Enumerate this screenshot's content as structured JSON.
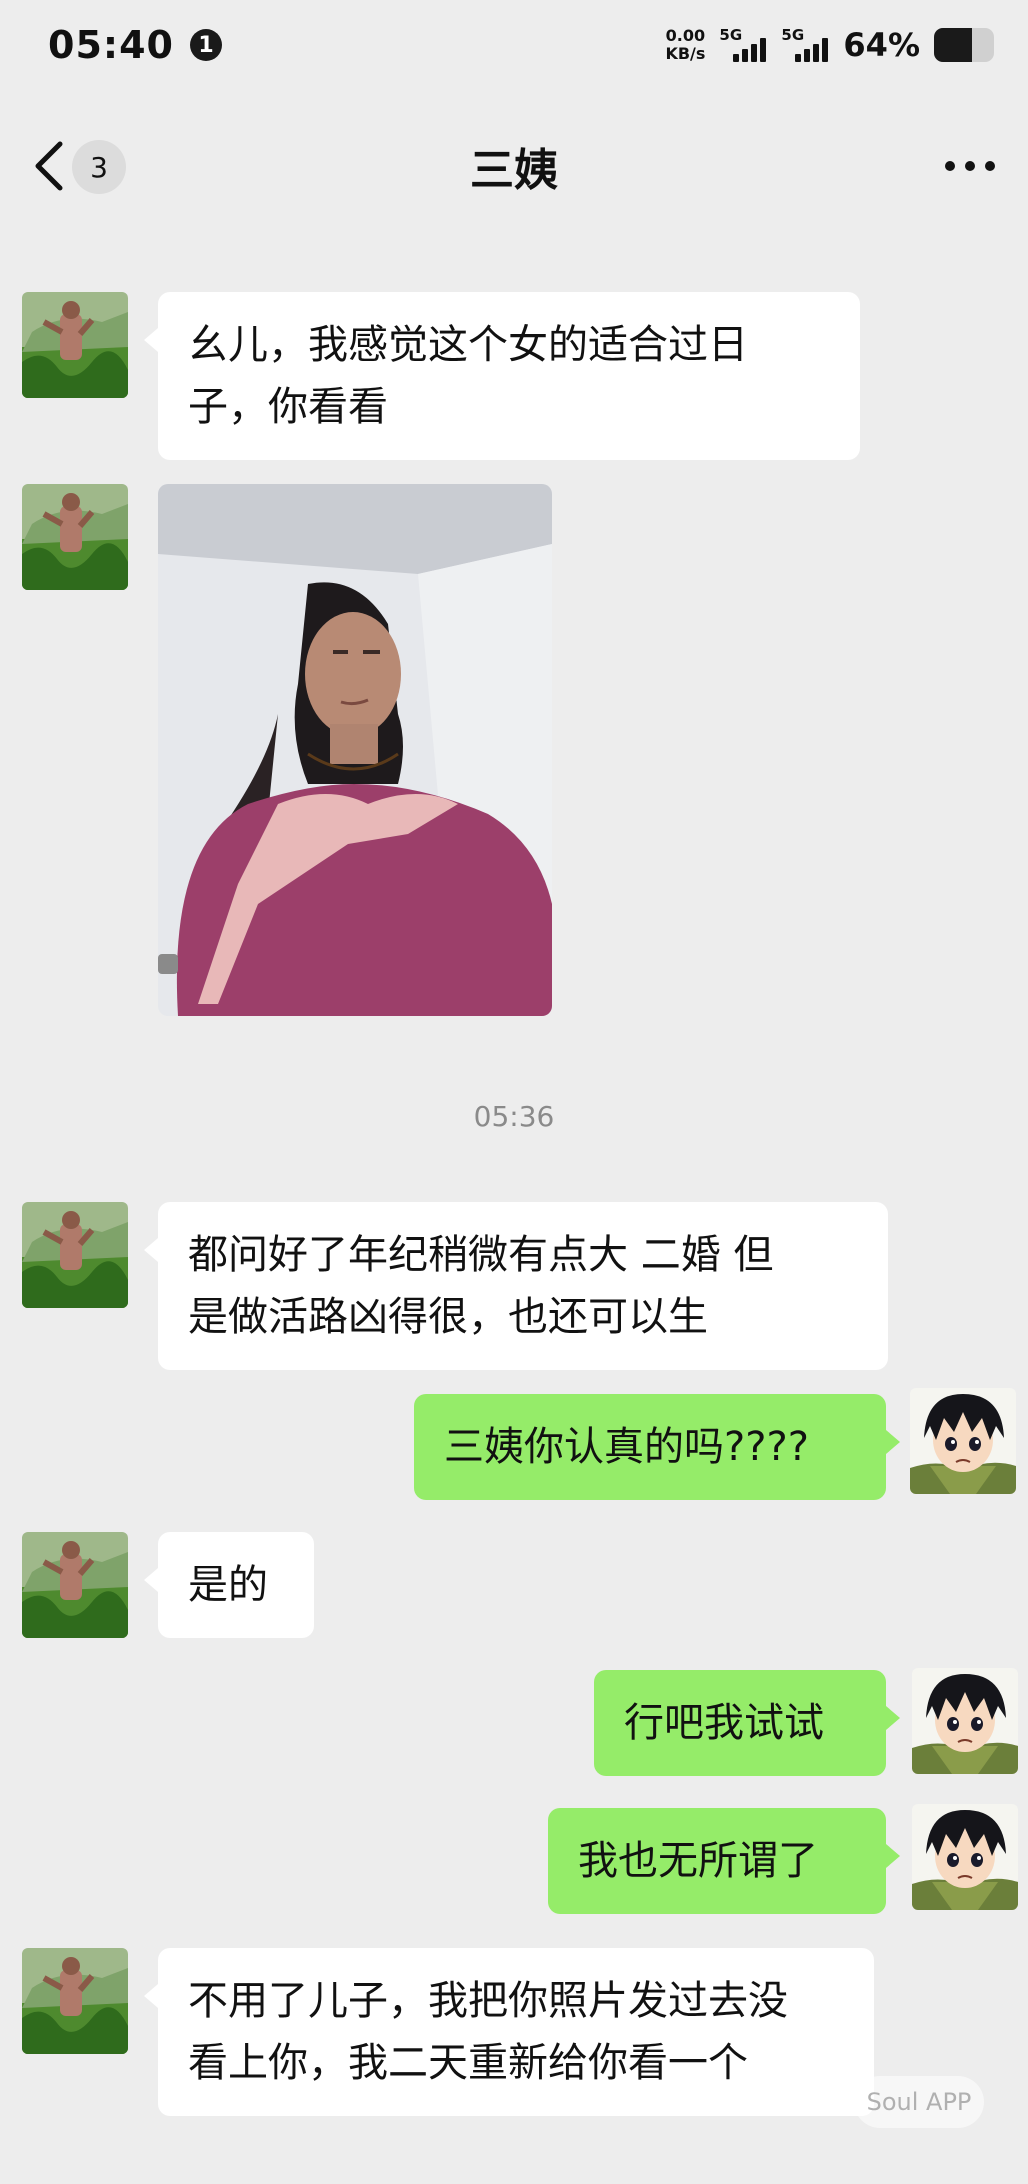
{
  "status_bar": {
    "time": "05:40",
    "notification_count": "1",
    "net_speed_value": "0.00",
    "net_speed_unit": "KB/s",
    "sim1_label": "5G",
    "sim2_label": "5G",
    "battery_percent_text": "64%",
    "battery_level": 0.64
  },
  "nav": {
    "unread_count": "3",
    "title": "三姨"
  },
  "messages": [
    {
      "sender": "contact",
      "type": "text",
      "text_line1": "幺儿，我感觉这个女的适合过日",
      "text_line2": "子，你看看"
    },
    {
      "sender": "contact",
      "type": "image"
    },
    {
      "type": "timestamp",
      "text": "05:36"
    },
    {
      "sender": "contact",
      "type": "text",
      "text_line1": "都问好了年纪稍微有点大 二婚 但",
      "text_line2": "是做活路凶得很，也还可以生"
    },
    {
      "sender": "me",
      "type": "text",
      "text": "三姨你认真的吗????"
    },
    {
      "sender": "contact",
      "type": "text",
      "text": "是的"
    },
    {
      "sender": "me",
      "type": "text",
      "text": "行吧我试试"
    },
    {
      "sender": "me",
      "type": "text",
      "text": "我也无所谓了"
    },
    {
      "sender": "contact",
      "type": "text",
      "text_line1": "不用了儿子，我把你照片发过去没",
      "text_line2": "看上你，我二天重新给你看一个"
    }
  ],
  "watermark": "Soul APP",
  "colors": {
    "background": "#ededed",
    "incoming_bubble": "#ffffff",
    "outgoing_bubble": "#95ec69"
  }
}
